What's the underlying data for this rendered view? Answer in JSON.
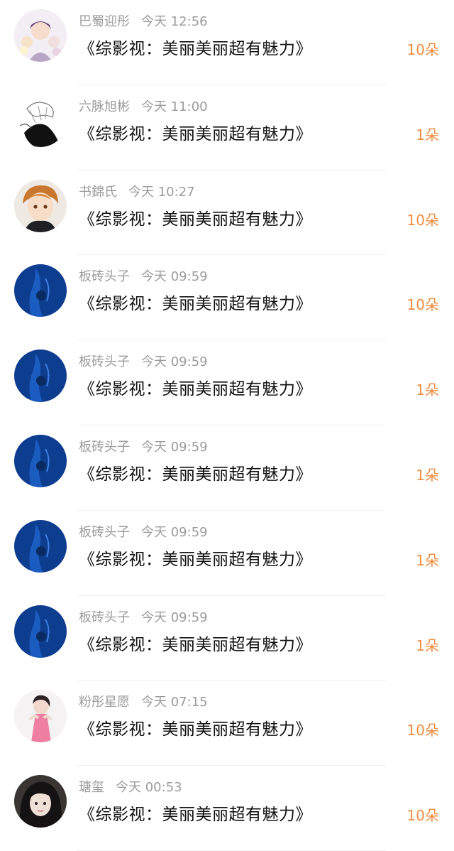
{
  "accent_color": "#f08c3e",
  "items": [
    {
      "name": "巴蜀迎彤",
      "time": "今天 12:56",
      "title": "《综影视：美丽美丽超有魅力》",
      "count": "10朵",
      "avatar_icon": "anime-group-avatar-icon"
    },
    {
      "name": "六脉旭彬",
      "time": "今天 11:00",
      "title": "《综影视：美丽美丽超有魅力》",
      "count": "1朵",
      "avatar_icon": "sketch-character-avatar-icon"
    },
    {
      "name": "书錦氏",
      "time": "今天 10:27",
      "title": "《综影视：美丽美丽超有魅力》",
      "count": "10朵",
      "avatar_icon": "anime-boy-avatar-icon"
    },
    {
      "name": "板砖头子",
      "time": "今天 09:59",
      "title": "《综影视：美丽美丽超有魅力》",
      "count": "10朵",
      "avatar_icon": "blue-dark-avatar-icon"
    },
    {
      "name": "板砖头子",
      "time": "今天 09:59",
      "title": "《综影视：美丽美丽超有魅力》",
      "count": "1朵",
      "avatar_icon": "blue-dark-avatar-icon"
    },
    {
      "name": "板砖头子",
      "time": "今天 09:59",
      "title": "《综影视：美丽美丽超有魅力》",
      "count": "1朵",
      "avatar_icon": "blue-dark-avatar-icon"
    },
    {
      "name": "板砖头子",
      "time": "今天 09:59",
      "title": "《综影视：美丽美丽超有魅力》",
      "count": "1朵",
      "avatar_icon": "blue-dark-avatar-icon"
    },
    {
      "name": "板砖头子",
      "time": "今天 09:59",
      "title": "《综影视：美丽美丽超有魅力》",
      "count": "1朵",
      "avatar_icon": "blue-dark-avatar-icon"
    },
    {
      "name": "粉彤星愿",
      "time": "今天 07:15",
      "title": "《综影视：美丽美丽超有魅力》",
      "count": "10朵",
      "avatar_icon": "pink-dress-photo-avatar-icon"
    },
    {
      "name": "瑭玺",
      "time": "今天 00:53",
      "title": "《综影视：美丽美丽超有魅力》",
      "count": "10朵",
      "avatar_icon": "girl-photo-avatar-icon"
    }
  ]
}
